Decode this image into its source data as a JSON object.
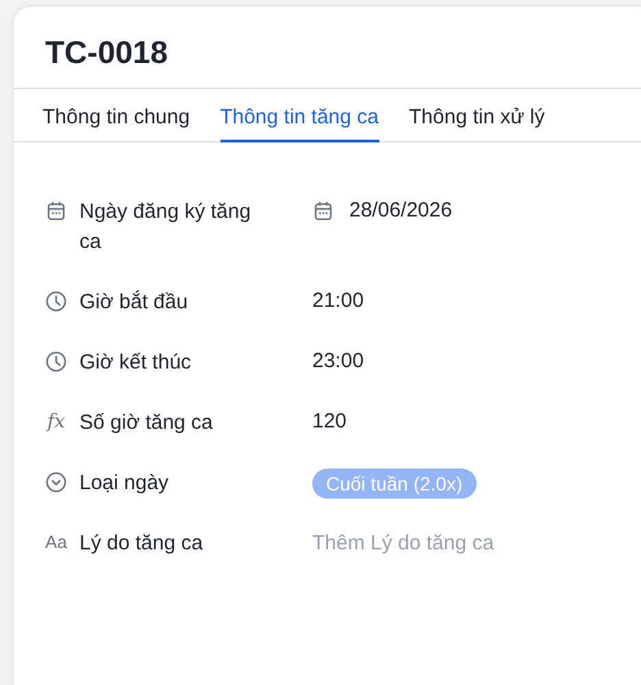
{
  "record": {
    "title": "TC-0018"
  },
  "tabs": [
    {
      "label": "Thông tin chung",
      "selected": false
    },
    {
      "label": "Thông tin tăng ca",
      "selected": true
    },
    {
      "label": "Thông tin xử lý",
      "selected": false
    }
  ],
  "fields": [
    {
      "kind": "date",
      "label": "Ngày đăng ký tăng ca",
      "value": "28/06/2026"
    },
    {
      "kind": "time",
      "label": "Giờ bắt đầu",
      "value": "21:00"
    },
    {
      "kind": "time",
      "label": "Giờ kết thúc",
      "value": "23:00"
    },
    {
      "kind": "formula",
      "icon_text": "fx",
      "label": "Số giờ tăng ca",
      "value": "120"
    },
    {
      "kind": "select",
      "label": "Loại ngày",
      "value": "Cuối tuần (2.0x)",
      "color": "#93b4f5"
    },
    {
      "kind": "text",
      "icon_text": "Aa",
      "label": "Lý do tăng ca",
      "placeholder": "Thêm Lý do tăng ca"
    }
  ]
}
